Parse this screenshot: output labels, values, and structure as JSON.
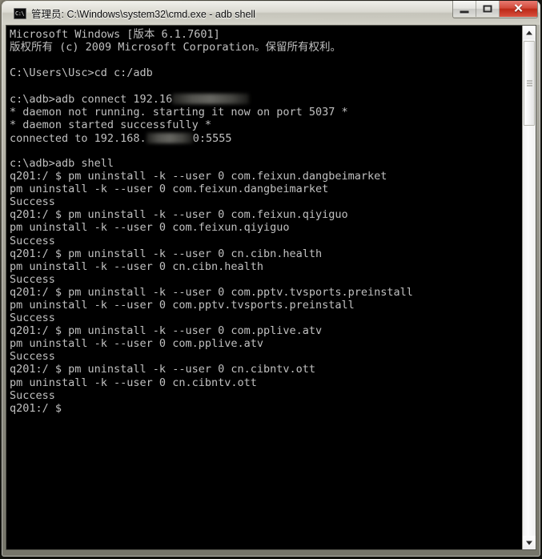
{
  "window": {
    "title": "管理员: C:\\Windows\\system32\\cmd.exe - adb  shell",
    "icon": "cmd-icon",
    "minimize_label": "",
    "maximize_label": "",
    "close_label": "✕",
    "background_color": "#000000",
    "text_color": "#c0c0c0",
    "close_button_color": "#bc2a18"
  },
  "console": {
    "prompt_windows": "c:\\adb>",
    "prompt_shell": "q201:/ $",
    "lines": [
      {
        "text": "Microsoft Windows [版本 6.1.7601]"
      },
      {
        "text": "版权所有 (c) 2009 Microsoft Corporation。保留所有权利。"
      },
      {
        "text": ""
      },
      {
        "text": "C:\\Users\\Usc>cd c:/adb"
      },
      {
        "text": ""
      },
      {
        "pre": "c:\\adb>adb connect 192.16",
        "redact_width": 96,
        "post": ""
      },
      {
        "text": "* daemon not running. starting it now on port 5037 *"
      },
      {
        "text": "* daemon started successfully *"
      },
      {
        "pre": "connected to 192.168.",
        "redact_width": 58,
        "post": "0:5555"
      },
      {
        "text": ""
      },
      {
        "text": "c:\\adb>adb shell"
      },
      {
        "text": "q201:/ $ pm uninstall -k --user 0 com.feixun.dangbeimarket"
      },
      {
        "text": "pm uninstall -k --user 0 com.feixun.dangbeimarket"
      },
      {
        "text": "Success"
      },
      {
        "text": "q201:/ $ pm uninstall -k --user 0 com.feixun.qiyiguo"
      },
      {
        "text": "pm uninstall -k --user 0 com.feixun.qiyiguo"
      },
      {
        "text": "Success"
      },
      {
        "text": "q201:/ $ pm uninstall -k --user 0 cn.cibn.health"
      },
      {
        "text": "pm uninstall -k --user 0 cn.cibn.health"
      },
      {
        "text": "Success"
      },
      {
        "text": "q201:/ $ pm uninstall -k --user 0 com.pptv.tvsports.preinstall"
      },
      {
        "text": "pm uninstall -k --user 0 com.pptv.tvsports.preinstall"
      },
      {
        "text": "Success"
      },
      {
        "text": "q201:/ $ pm uninstall -k --user 0 com.pplive.atv"
      },
      {
        "text": "pm uninstall -k --user 0 com.pplive.atv"
      },
      {
        "text": "Success"
      },
      {
        "text": "q201:/ $ pm uninstall -k --user 0 cn.cibntv.ott"
      },
      {
        "text": "pm uninstall -k --user 0 cn.cibntv.ott"
      },
      {
        "text": "Success"
      },
      {
        "text": "q201:/ $"
      }
    ]
  }
}
